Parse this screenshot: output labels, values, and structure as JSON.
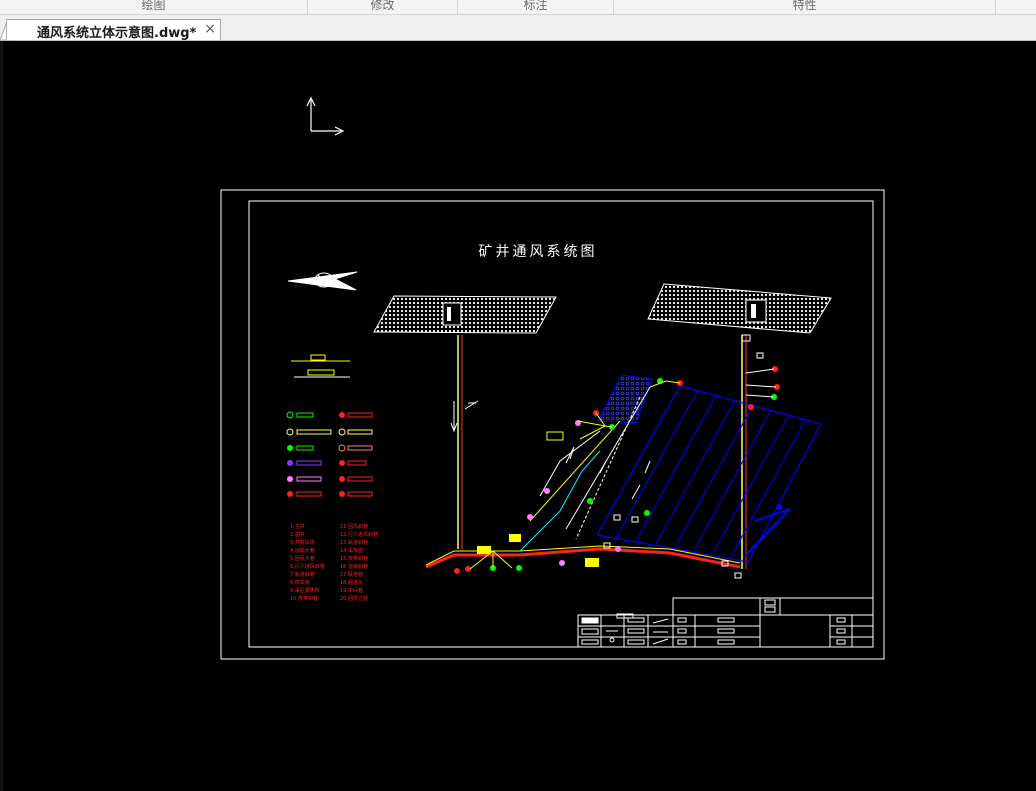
{
  "ribbon": {
    "groups": [
      {
        "label": "绘图"
      },
      {
        "label": "修改"
      },
      {
        "label": "标注"
      },
      {
        "label": "特性"
      }
    ]
  },
  "tab": {
    "filename": "通风系统立体示意图.dwg*",
    "close_glyph": "×"
  },
  "drawing": {
    "title": "矿井通风系统图"
  },
  "colors": {
    "background": "#000000",
    "frame": "#ffffff",
    "airway_blue": "#0000ff",
    "intake_red": "#ff0000",
    "return_yellow": "#ffff00",
    "shaft_yellow": "#ffff66",
    "label_red": "#ff2020"
  },
  "legend_labels": [
    "1.主井",
    "2.副井",
    "3.井底车场",
    "4.运输大巷",
    "5.回风大巷",
    "6.行人进风斜巷",
    "7.轨道斜巷",
    "8.绞车房",
    "9.采区变电所",
    "10.皮带斜巷",
    "11.回风斜巷",
    "12.行人进风斜巷",
    "13.轨道斜巷",
    "14.采煤面",
    "15.皮带斜巷",
    "16.运输斜巷",
    "17.联络巷",
    "18.掘进头",
    "19.中间巷",
    "20.回风立井"
  ]
}
